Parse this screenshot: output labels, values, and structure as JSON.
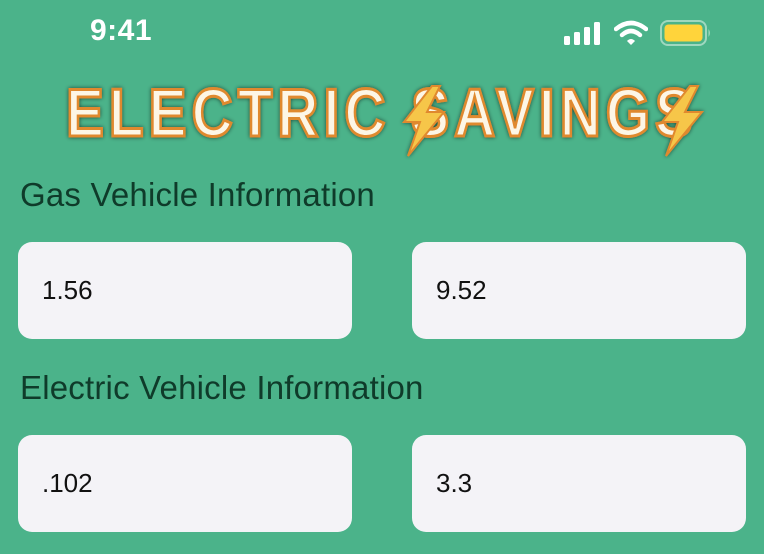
{
  "status_bar": {
    "time": "9:41",
    "icons": [
      "cellular-signal-icon",
      "wifi-icon",
      "battery-icon"
    ],
    "battery_color": "#ffd43b"
  },
  "logo": {
    "text": "ELECTRIC SAVINGS",
    "text_color": "#fdf6e6",
    "outline_color": "#e0892d",
    "bolt_color": "#f6c64a"
  },
  "gas_section": {
    "title": "Gas Vehicle Information",
    "fields": [
      {
        "value": "1.56"
      },
      {
        "value": "9.52"
      }
    ]
  },
  "electric_section": {
    "title": "Electric Vehicle Information",
    "fields": [
      {
        "value": ".102"
      },
      {
        "value": "3.3"
      }
    ]
  },
  "colors": {
    "background": "#4bb38a",
    "field_background": "#f4f3f7",
    "section_title": "#0f3b2a"
  }
}
